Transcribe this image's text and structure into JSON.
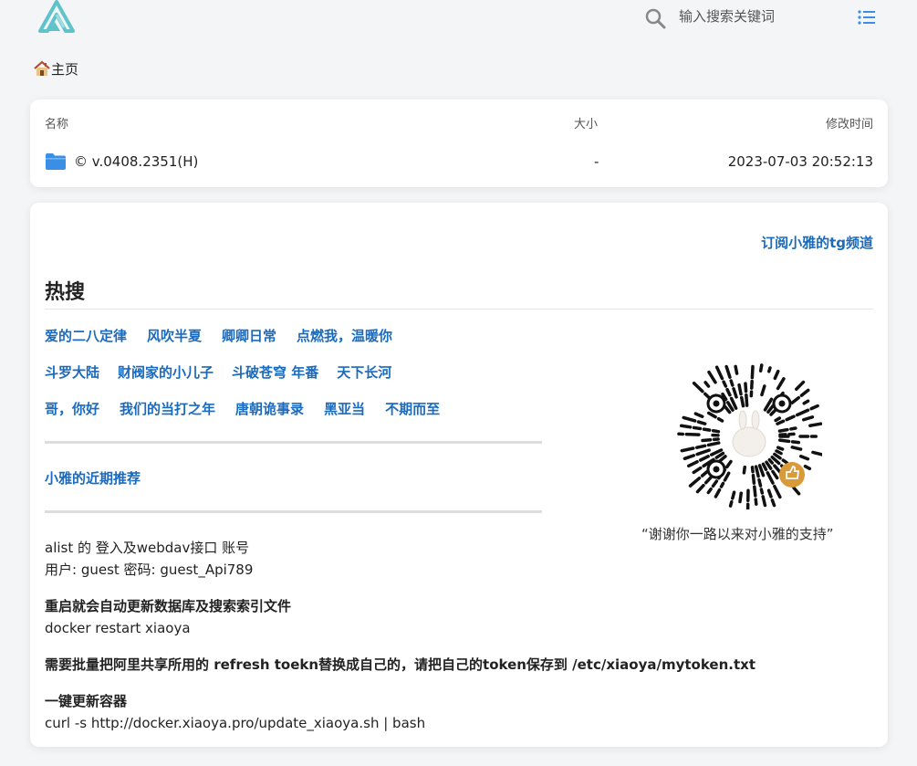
{
  "header": {
    "search_placeholder": "输入搜索关键词"
  },
  "breadcrumb": {
    "home_label": "主页"
  },
  "file_list": {
    "columns": {
      "name": "名称",
      "size": "大小",
      "modified": "修改时间"
    },
    "rows": [
      {
        "name": "© v.0408.2351(H)",
        "size": "-",
        "modified": "2023-07-03 20:52:13",
        "icon": "folder-icon"
      }
    ]
  },
  "readme": {
    "tg_link": "订阅小雅的tg频道",
    "hot_title": "热搜",
    "hot_rows": [
      [
        "爱的二八定律",
        "风吹半夏",
        "卿卿日常",
        "点燃我，温暖你"
      ],
      [
        "斗罗大陆",
        "财阀家的小儿子",
        "斗破苍穹 年番",
        "天下长河"
      ],
      [
        "哥，你好",
        "我们的当打之年",
        "唐朝诡事录",
        "黑亚当",
        "不期而至"
      ]
    ],
    "recommend_link": "小雅的近期推荐",
    "qr_caption": "“谢谢你一路以来对小雅的支持”",
    "blocks": [
      {
        "line1": "alist 的 登入及webdav接口 账号",
        "line2": "用户: guest 密码: guest_Api789"
      },
      {
        "line1": "重启就会自动更新数据库及搜索索引文件",
        "line2": "docker restart xiaoya"
      },
      {
        "line1": "需要批量把阿里共享所用的 refresh toekn替换成自己的，请把自己的token保存到 /etc/xiaoya/mytoken.txt",
        "line2": ""
      },
      {
        "line1": "一键更新容器",
        "line2": "curl -s http://docker.xiaoya.pro/update_xiaoya.sh | bash"
      }
    ]
  },
  "colors": {
    "link": "#1a6bbf",
    "logo_teal": "#5fc4c9",
    "folder_blue": "#3a8ee6",
    "qr_badge": "#d99a3a"
  }
}
